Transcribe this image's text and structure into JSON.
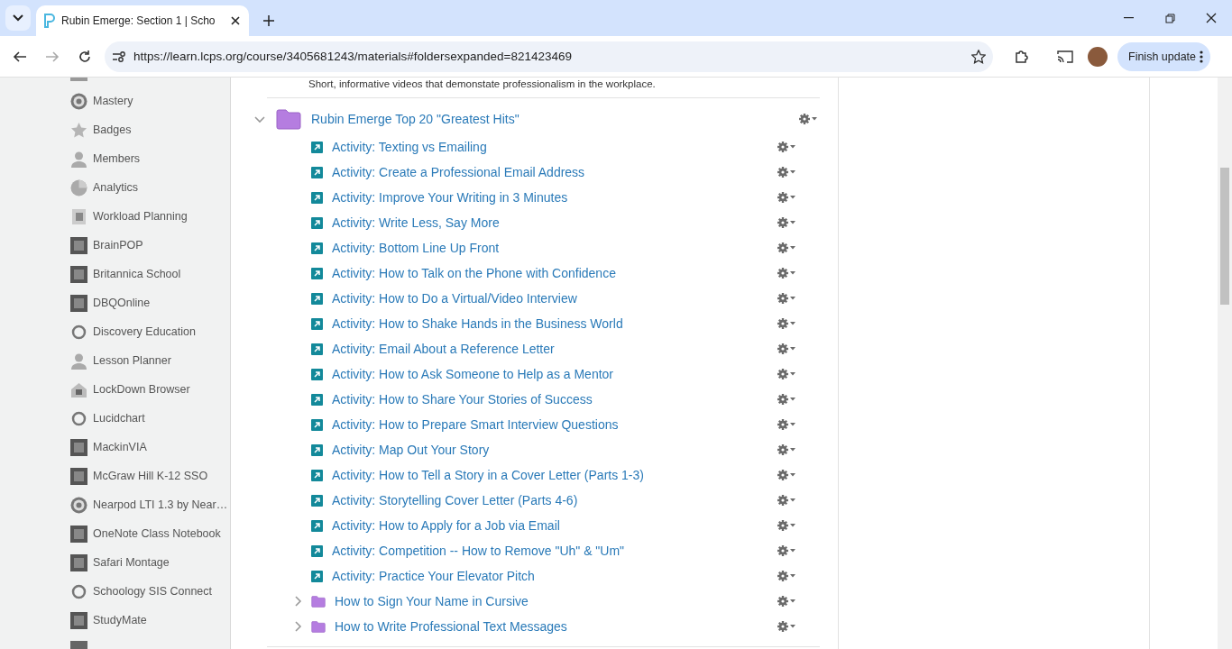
{
  "browser": {
    "tab_title": "Rubin Emerge: Section 1 | Scho",
    "url": "https://learn.lcps.org/course/3405681243/materials#foldersexpanded=821423469",
    "update_button": "Finish update"
  },
  "sidebar": {
    "items": [
      {
        "label": "Mastery"
      },
      {
        "label": "Badges"
      },
      {
        "label": "Members"
      },
      {
        "label": "Analytics"
      },
      {
        "label": "Workload Planning"
      },
      {
        "label": "BrainPOP"
      },
      {
        "label": "Britannica School"
      },
      {
        "label": "DBQOnline"
      },
      {
        "label": "Discovery Education"
      },
      {
        "label": "Lesson Planner"
      },
      {
        "label": "LockDown Browser"
      },
      {
        "label": "Lucidchart"
      },
      {
        "label": "MackinVIA"
      },
      {
        "label": "McGraw Hill K-12 SSO"
      },
      {
        "label": "Nearpod LTI 1.3 by Near…"
      },
      {
        "label": "OneNote Class Notebook"
      },
      {
        "label": "Safari Montage"
      },
      {
        "label": "Schoology SIS Connect"
      },
      {
        "label": "StudyMate"
      }
    ]
  },
  "materials": {
    "description": "Short, informative videos that demonstate professionalism in the workplace.",
    "folder": {
      "title": "Rubin Emerge Top 20 \"Greatest Hits\"",
      "expanded": true,
      "children": [
        {
          "kind": "link",
          "title": "Activity: Texting vs Emailing"
        },
        {
          "kind": "link",
          "title": "Activity: Create a Professional Email Address"
        },
        {
          "kind": "link",
          "title": "Activity: Improve Your Writing in 3 Minutes"
        },
        {
          "kind": "link",
          "title": "Activity: Write Less, Say More"
        },
        {
          "kind": "link",
          "title": "Activity: Bottom Line Up Front"
        },
        {
          "kind": "link",
          "title": "Activity: How to Talk on the Phone with Confidence"
        },
        {
          "kind": "link",
          "title": "Activity: How to Do a Virtual/Video Interview"
        },
        {
          "kind": "link",
          "title": "Activity: How to Shake Hands in the Business World"
        },
        {
          "kind": "link",
          "title": "Activity: Email About a Reference Letter"
        },
        {
          "kind": "link",
          "title": "Activity: How to Ask Someone to Help as a Mentor"
        },
        {
          "kind": "link",
          "title": "Activity: How to Share Your Stories of Success"
        },
        {
          "kind": "link",
          "title": "Activity: How to Prepare Smart Interview Questions"
        },
        {
          "kind": "link",
          "title": "Activity: Map Out Your Story"
        },
        {
          "kind": "link",
          "title": "Activity: How to Tell a Story in a Cover Letter (Parts 1-3)"
        },
        {
          "kind": "link",
          "title": "Activity: Storytelling Cover Letter (Parts 4-6)"
        },
        {
          "kind": "link",
          "title": "Activity: How to Apply for a Job via Email"
        },
        {
          "kind": "link",
          "title": "Activity: Competition -- How to Remove \"Uh\" & \"Um\""
        },
        {
          "kind": "link",
          "title": "Activity: Practice Your Elevator Pitch"
        },
        {
          "kind": "folder",
          "title": "How to Sign Your Name in Cursive",
          "expanded": false
        },
        {
          "kind": "folder",
          "title": "How to Write Professional Text Messages",
          "expanded": false
        }
      ]
    }
  }
}
